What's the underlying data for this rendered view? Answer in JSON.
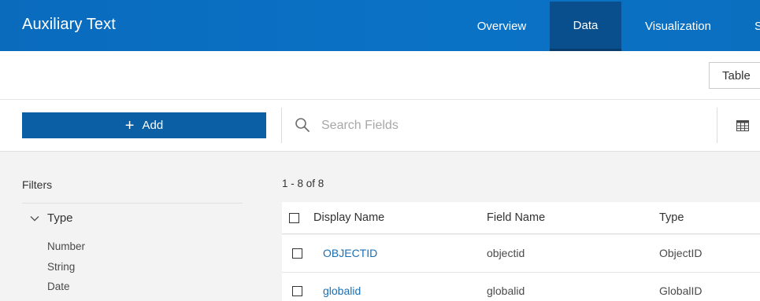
{
  "header": {
    "title": "Auxiliary Text",
    "tabs": [
      {
        "label": "Overview",
        "active": false
      },
      {
        "label": "Data",
        "active": true
      },
      {
        "label": "Visualization",
        "active": false
      },
      {
        "label": "S",
        "active": false
      }
    ]
  },
  "toolbar": {
    "view_toggle_label": "Table"
  },
  "actions": {
    "add_label": "Add",
    "search_placeholder": "Search Fields"
  },
  "filters": {
    "title": "Filters",
    "group_label": "Type",
    "items": [
      "Number",
      "String",
      "Date"
    ]
  },
  "table": {
    "count_text": "1 - 8 of 8",
    "columns": [
      "Display Name",
      "Field Name",
      "Type"
    ],
    "rows": [
      {
        "display_name": "OBJECTID",
        "field_name": "objectid",
        "type": "ObjectID"
      },
      {
        "display_name": "globalid",
        "field_name": "globalid",
        "type": "GlobalID"
      }
    ]
  },
  "colors": {
    "header_bg": "#0a6bbd",
    "active_tab_bg": "#0a4f8d",
    "add_button_bg": "#0b5fa5",
    "link": "#1a6fb5",
    "panel_bg": "#f3f3f3"
  },
  "icons": [
    "search-icon",
    "table-view-icon",
    "plus-icon",
    "chevron-down-icon",
    "checkbox"
  ]
}
